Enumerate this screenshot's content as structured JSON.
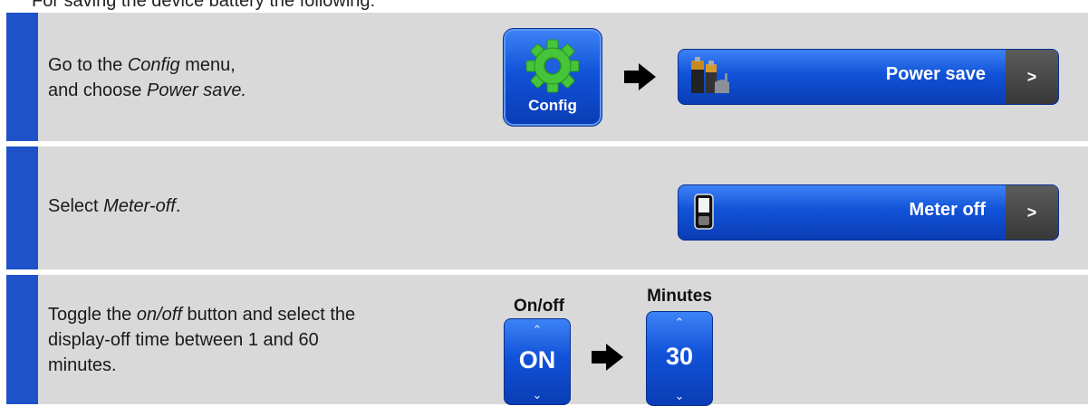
{
  "intro": "For saving the device battery the following:",
  "steps": [
    {
      "pre": "Go to the ",
      "em1": "Config",
      "mid": " menu,",
      "line2_pre": "and choose ",
      "em2": "Power save."
    },
    {
      "pre": "Select ",
      "em1": "Meter-off",
      "post": "."
    },
    {
      "pre": "Toggle the ",
      "em1": "on/off",
      "post": " button and select the",
      "line2": "display-off time between 1 and 60",
      "line3": "minutes."
    }
  ],
  "config_button": {
    "label": "Config",
    "icon": "gear-icon"
  },
  "power_save": {
    "label": "Power save",
    "chevron": ">",
    "icon": "battery-icon"
  },
  "meter_off": {
    "label": "Meter off",
    "chevron": ">",
    "icon": "meter-device-icon"
  },
  "onoff": {
    "title": "On/off",
    "value": "ON",
    "up": "⌃",
    "down": "⌄"
  },
  "minutes": {
    "title": "Minutes",
    "value": "30",
    "up": "⌃",
    "down": "⌄"
  },
  "colors": {
    "accent_bar": "#1f51c8",
    "panel": "#d9d9d9",
    "button_blue": "#1152d8",
    "gear_green": "#46c53b"
  }
}
